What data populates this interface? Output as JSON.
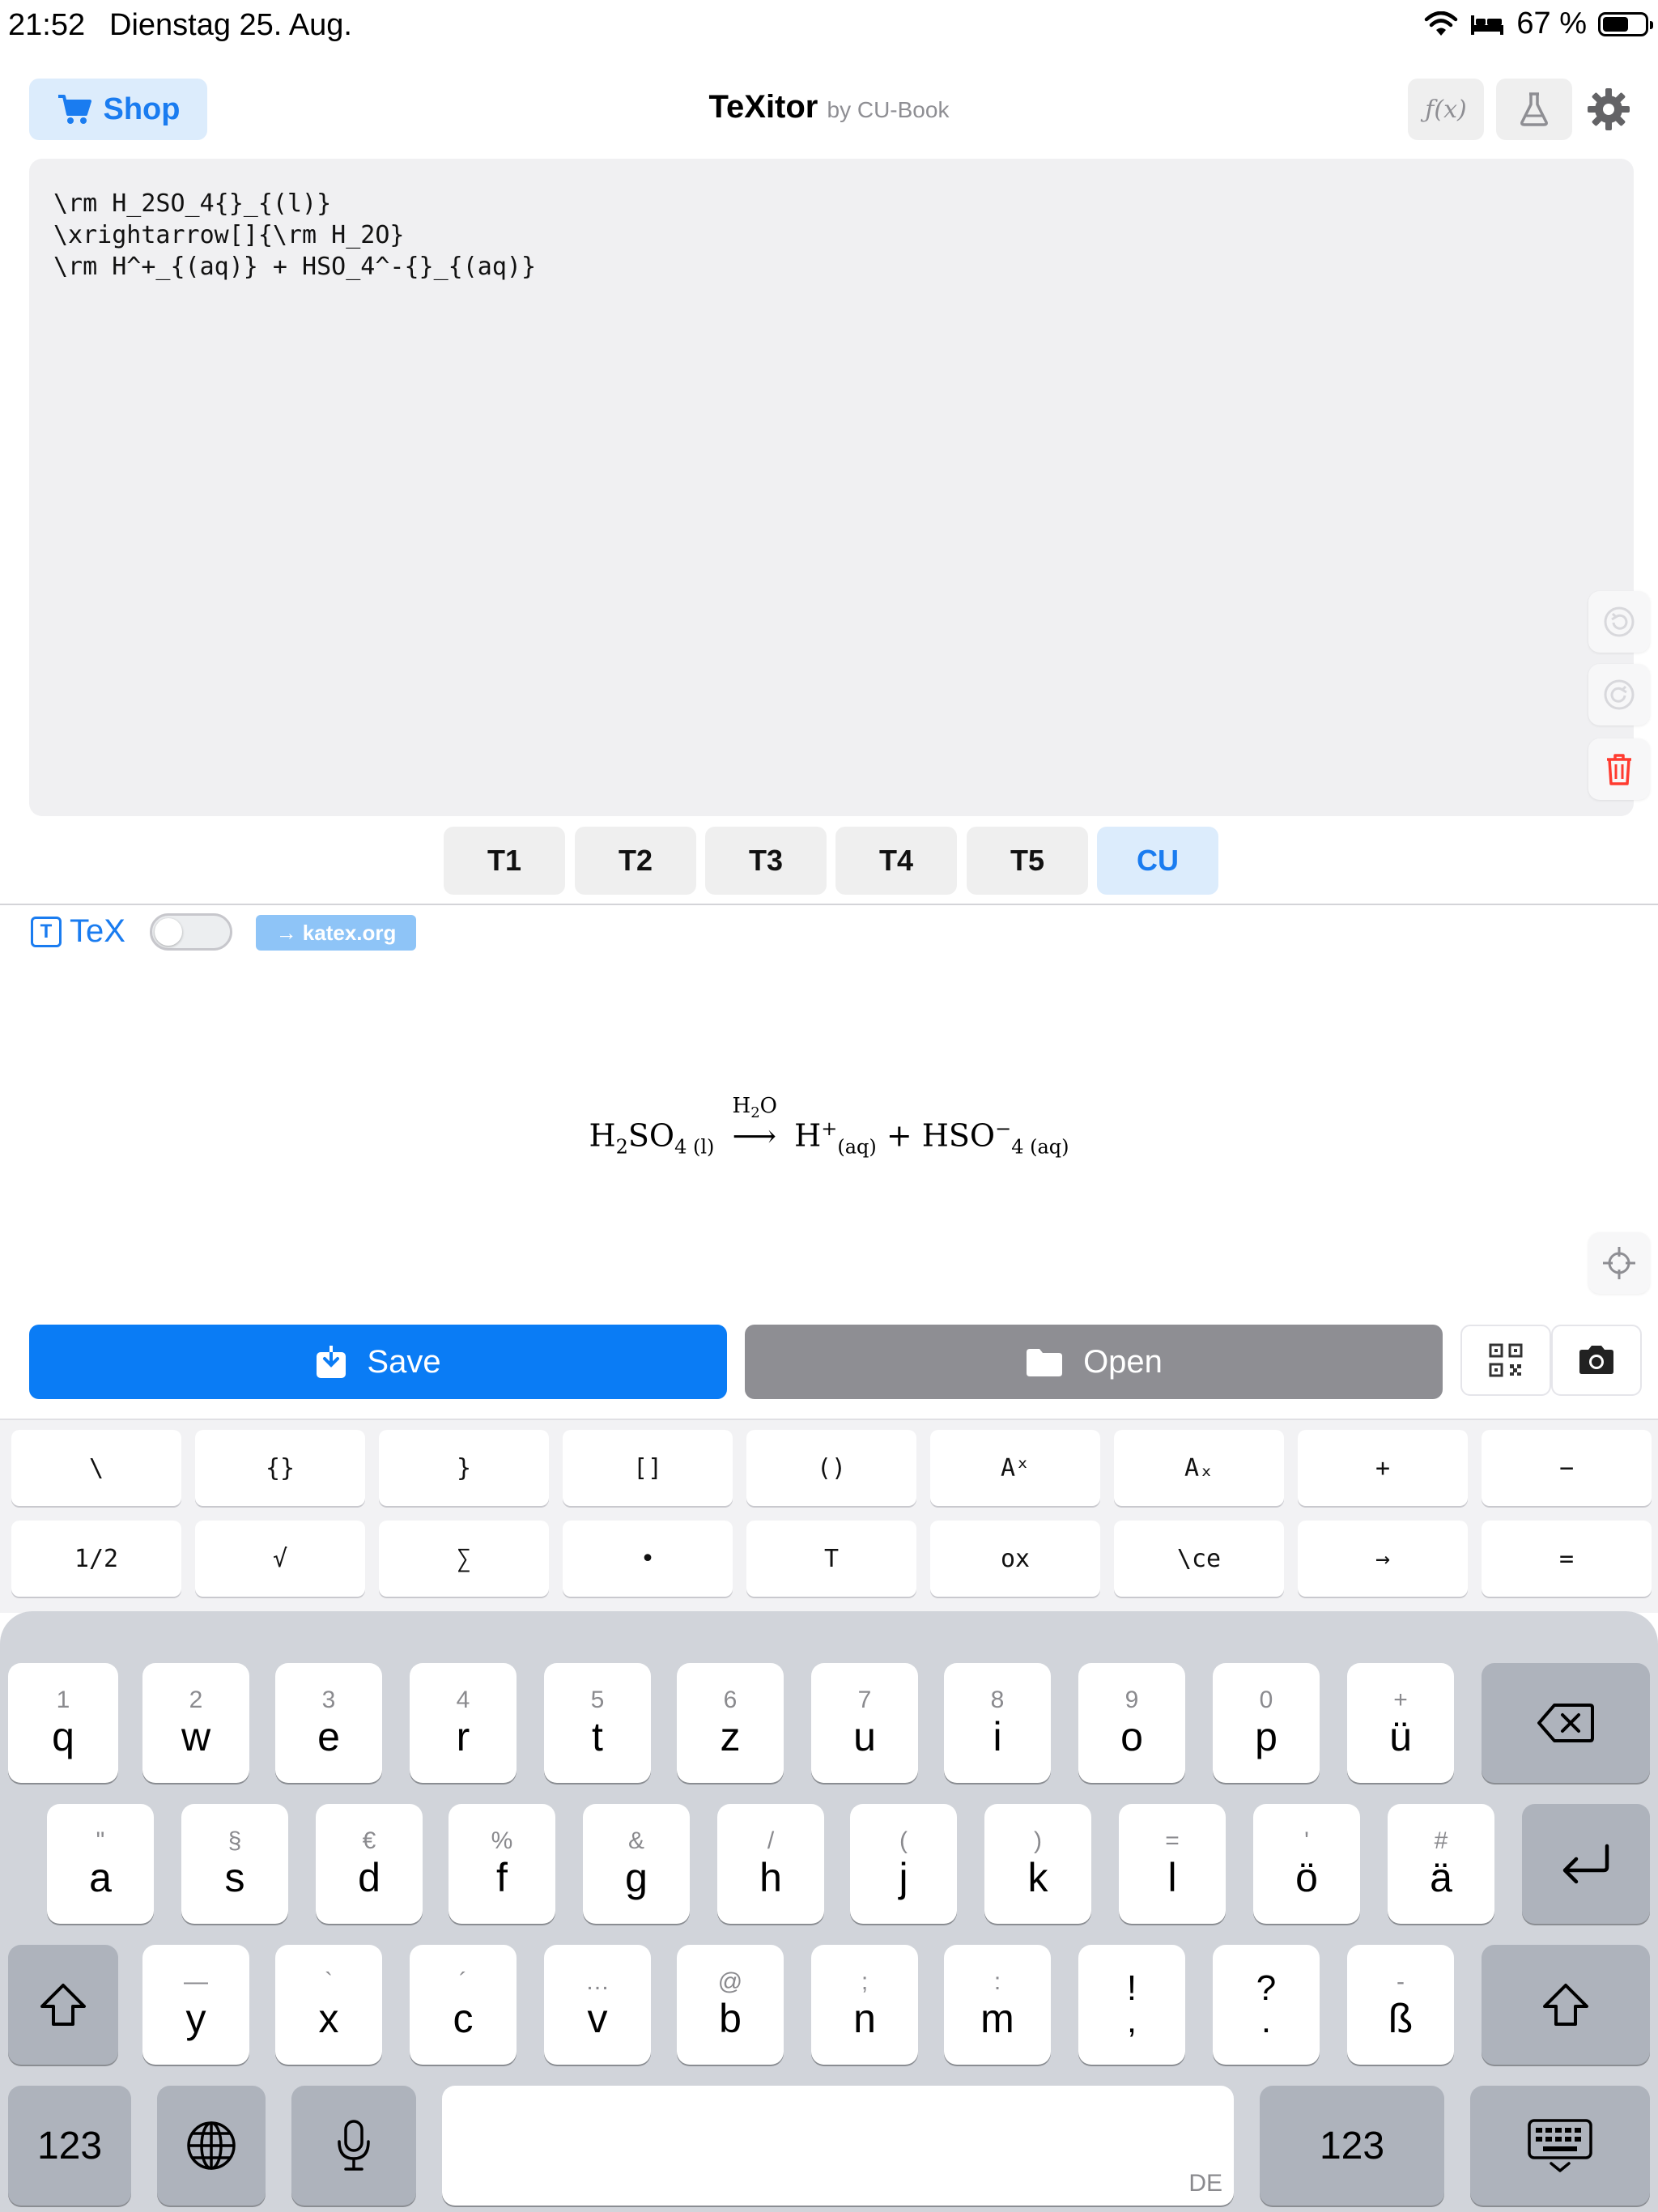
{
  "status": {
    "time": "21:52",
    "date": "Dienstag 25. Aug.",
    "battery": "67 %"
  },
  "header": {
    "shop_label": "Shop",
    "title": "TeXitor",
    "subtitle": "by CU-Book",
    "fx_label": "ƒ(x)"
  },
  "editor": {
    "lines": [
      "\\rm H_2SO_4{}_{(l)}",
      "\\xrightarrow[]{\\rm H_2O}",
      "\\rm H^+_{(aq)} + HSO_4^-{}_{(aq)}"
    ]
  },
  "tabs": [
    {
      "label": "T1",
      "active": false
    },
    {
      "label": "T2",
      "active": false
    },
    {
      "label": "T3",
      "active": false
    },
    {
      "label": "T4",
      "active": false
    },
    {
      "label": "T5",
      "active": false
    },
    {
      "label": "CU",
      "active": true
    }
  ],
  "preview": {
    "tex_label": "TeX",
    "tex_icon": "T",
    "katex_link": "→ katex.org",
    "toggle_on": false
  },
  "formula": {
    "h2so4_h": "H",
    "h2so4_2": "2",
    "h2so4_so": "SO",
    "h2so4_4": "4",
    "h2so4_phase": "(l)",
    "arrow_label_h": "H",
    "arrow_label_2": "2",
    "arrow_label_o": "O",
    "arrow": "⟶",
    "hplus": "H",
    "plus_charge": "+",
    "aq1": "(aq)",
    "plus": "+",
    "hso": "HSO",
    "hso_4": "4",
    "minus_charge": "−",
    "aq2": "(aq)"
  },
  "actions": {
    "save_label": "Save",
    "open_label": "Open"
  },
  "accessory_row1": [
    "\\",
    "{}",
    "}",
    "[]",
    "()",
    "Aˣ",
    "Aₓ",
    "+",
    "−"
  ],
  "accessory_row2": [
    "1/2",
    "√",
    "∑",
    "•",
    "T",
    "ox",
    "\\ce",
    "→",
    "="
  ],
  "keyboard": {
    "row1": [
      {
        "hint": "1",
        "main": "q"
      },
      {
        "hint": "2",
        "main": "w"
      },
      {
        "hint": "3",
        "main": "e"
      },
      {
        "hint": "4",
        "main": "r"
      },
      {
        "hint": "5",
        "main": "t"
      },
      {
        "hint": "6",
        "main": "z"
      },
      {
        "hint": "7",
        "main": "u"
      },
      {
        "hint": "8",
        "main": "i"
      },
      {
        "hint": "9",
        "main": "o"
      },
      {
        "hint": "0",
        "main": "p"
      },
      {
        "hint": "+",
        "main": "ü"
      }
    ],
    "row2": [
      {
        "hint": "\"",
        "main": "a"
      },
      {
        "hint": "§",
        "main": "s"
      },
      {
        "hint": "€",
        "main": "d"
      },
      {
        "hint": "%",
        "main": "f"
      },
      {
        "hint": "&",
        "main": "g"
      },
      {
        "hint": "/",
        "main": "h"
      },
      {
        "hint": "(",
        "main": "j"
      },
      {
        "hint": ")",
        "main": "k"
      },
      {
        "hint": "=",
        "main": "l"
      },
      {
        "hint": "'",
        "main": "ö"
      },
      {
        "hint": "#",
        "main": "ä"
      }
    ],
    "row3": [
      {
        "hint": "—",
        "main": "y"
      },
      {
        "hint": "`",
        "main": "x"
      },
      {
        "hint": "´",
        "main": "c"
      },
      {
        "hint": "…",
        "main": "v"
      },
      {
        "hint": "@",
        "main": "b"
      },
      {
        "hint": ";",
        "main": "n"
      },
      {
        "hint": ":",
        "main": "m"
      },
      {
        "hint": "!",
        "main": ","
      },
      {
        "hint": "?",
        "main": "."
      },
      {
        "hint": "-",
        "main": "ß"
      }
    ],
    "numbers_label": "123",
    "space_lang": "DE"
  }
}
